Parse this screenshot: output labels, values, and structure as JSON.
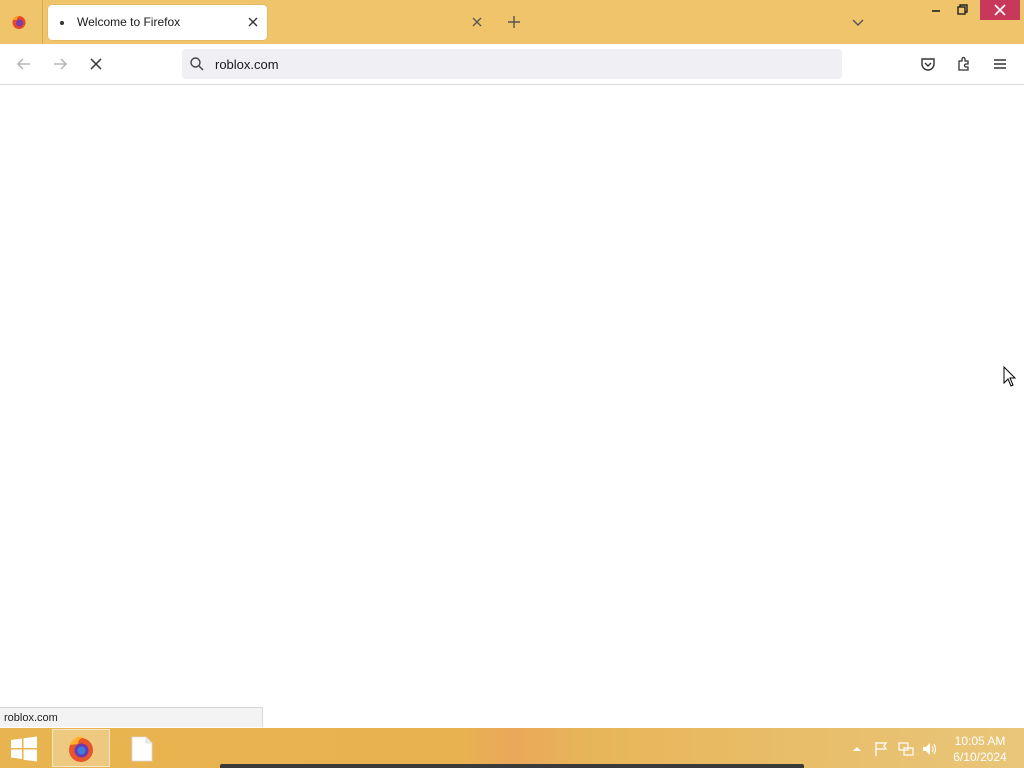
{
  "browser": {
    "tabs": [
      {
        "title": "Welcome to Firefox",
        "active": true
      }
    ],
    "url": "roblox.com",
    "status_text": "roblox.com",
    "theme_color": "#efc46a"
  },
  "taskbar": {
    "time": "10:05 AM",
    "date": "6/10/2024"
  }
}
